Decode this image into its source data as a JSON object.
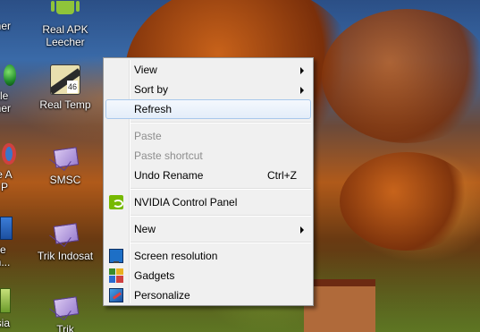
{
  "desktop_icons": [
    {
      "name": "aner",
      "label": "aner"
    },
    {
      "name": "real-apk-leecher",
      "label_line1": "Real APK",
      "label_line2": "Leecher"
    },
    {
      "name": "obile",
      "label_line1": "bile",
      "label_line2": "aner"
    },
    {
      "name": "real-temp",
      "label": "Real Temp",
      "badge": "46"
    },
    {
      "name": "me-a",
      "label_line1": "me A",
      "label_line2": "d P"
    },
    {
      "name": "smsc",
      "label": "SMSC"
    },
    {
      "name": "be-sh",
      "label_line1": "be",
      "label_line2": "sh..."
    },
    {
      "name": "trik-indosat",
      "label": "Trik Indosat"
    },
    {
      "name": "asia",
      "label": "asia"
    },
    {
      "name": "trik",
      "label": "Trik"
    }
  ],
  "context_menu": {
    "items": [
      {
        "label": "View",
        "submenu": true
      },
      {
        "label": "Sort by",
        "submenu": true
      },
      {
        "label": "Refresh",
        "highlighted": true
      },
      {
        "label": "Paste",
        "disabled": true
      },
      {
        "label": "Paste shortcut",
        "disabled": true
      },
      {
        "label": "Undo Rename",
        "shortcut": "Ctrl+Z"
      },
      {
        "label": "NVIDIA Control Panel",
        "icon": "nvidia-icon"
      },
      {
        "label": "New",
        "submenu": true
      },
      {
        "label": "Screen resolution",
        "icon": "screen-resolution-icon"
      },
      {
        "label": "Gadgets",
        "icon": "gadgets-icon"
      },
      {
        "label": "Personalize",
        "icon": "personalize-icon"
      }
    ]
  },
  "colors": {
    "menu_background": "#f0f0f0",
    "menu_highlight_border": "#a8c8ec",
    "disabled_text": "#8d8d8d",
    "nvidia_green": "#76b900"
  }
}
